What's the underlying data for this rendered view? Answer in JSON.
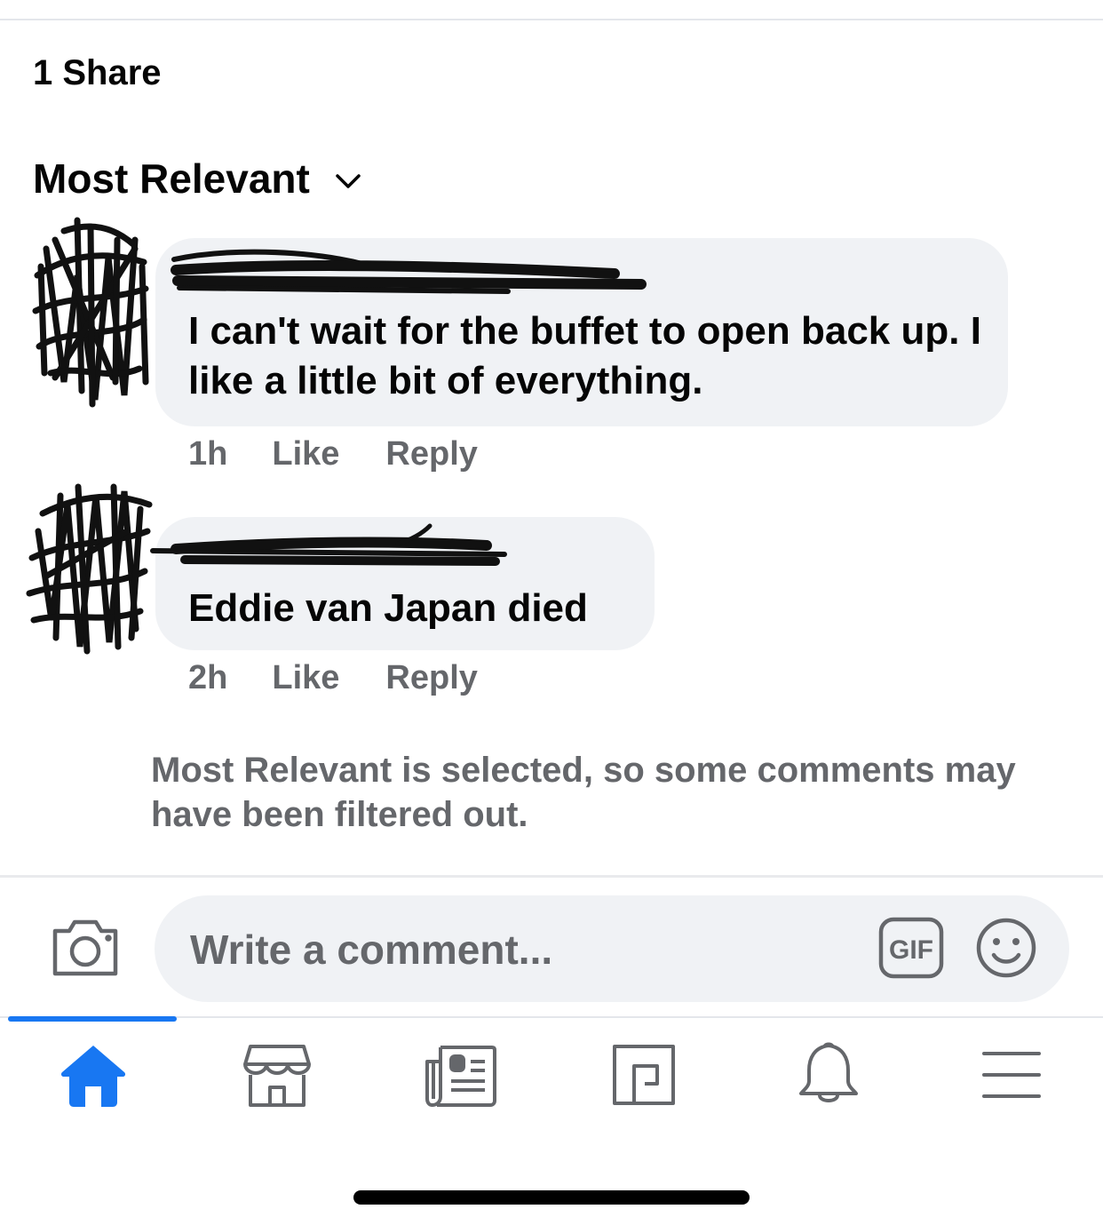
{
  "post": {
    "share_count": "1 Share",
    "sort_label": "Most Relevant"
  },
  "comments": [
    {
      "text": "I can't wait for the buffet to open back up. I like a little bit of everything.",
      "time": "1h",
      "like_label": "Like",
      "reply_label": "Reply"
    },
    {
      "text": "Eddie van Japan died",
      "time": "2h",
      "like_label": "Like",
      "reply_label": "Reply"
    }
  ],
  "filter_note": "Most Relevant is selected, so some comments may have been filtered out.",
  "composer": {
    "placeholder": "Write a comment...",
    "gif_label": "GIF"
  },
  "bottom_nav": {
    "items": [
      "home-icon",
      "marketplace-icon",
      "news-icon",
      "pages-icon",
      "bell-icon",
      "menu-icon"
    ],
    "active_color": "#1877f2"
  },
  "colors": {
    "secondary_text": "#65676b",
    "bubble": "#f0f2f5"
  }
}
